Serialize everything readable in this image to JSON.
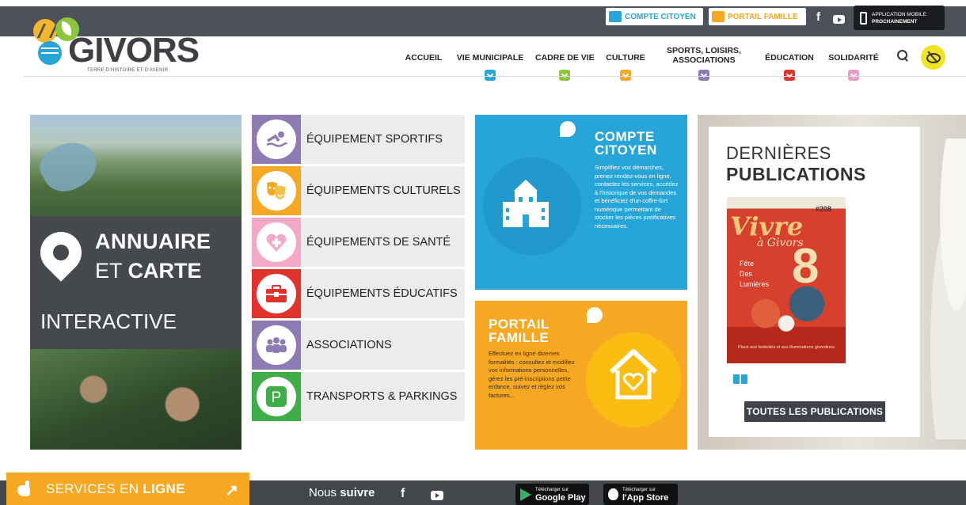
{
  "topbar": {
    "compte_citoyen": "COMPTE CITOYEN",
    "portail_famille": "PORTAIL FAMILLE",
    "facebook": "f",
    "app_line1": "APPLICATION MOBILE",
    "app_line2": "PROCHAINEMENT"
  },
  "logo": {
    "name": "GIVORS",
    "tagline": "TERRE D'HISTOIRE ET D'AVENIR"
  },
  "nav": {
    "items": [
      {
        "label": "ACCUEIL",
        "color": ""
      },
      {
        "label": "VIE MUNICIPALE",
        "color": "#27a4d8"
      },
      {
        "label": "CADRE DE VIE",
        "color": "#8cc63f"
      },
      {
        "label": "CULTURE",
        "color": "#f7a823"
      },
      {
        "label": "SPORTS, LOISIRS,",
        "label2": "ASSOCIATIONS",
        "color": "#8e7bb3"
      },
      {
        "label": "ÉDUCATION",
        "color": "#e0332b"
      },
      {
        "label": "SOLIDARITÉ",
        "color": "#e89cc8"
      }
    ]
  },
  "annuaire": {
    "line1": "ANNUAIRE",
    "line2a": "ET ",
    "line2b": "CARTE",
    "line3": "INTERACTIVE"
  },
  "equipements": [
    {
      "label": "ÉQUIPEMENT SPORTIFS",
      "icon": "swimmer-icon",
      "color": "#8e7bb3"
    },
    {
      "label": "ÉQUIPEMENTS CULTURELS",
      "icon": "theater-masks-icon",
      "color": "#f7a823"
    },
    {
      "label": "ÉQUIPEMENTS DE SANTÉ",
      "icon": "heart-cross-icon",
      "color": "#f4a8c8"
    },
    {
      "label": "ÉQUIPEMENTS ÉDUCATIFS",
      "icon": "briefcase-icon",
      "color": "#e0332b"
    },
    {
      "label": "ASSOCIATIONS",
      "icon": "group-icon",
      "color": "#8e7bb3"
    },
    {
      "label": "TRANSPORTS & PARKINGS",
      "icon": "parking-icon",
      "color": "#3fae49"
    }
  ],
  "citoyen": {
    "title1": "COMPTE",
    "title2": "CITOYEN",
    "desc": "Simplifiez vos démarches, prenez rendez-vous en ligne, contactez les services, accédez à l'historique de vos demandes et bénéficiez d'un coffre-fort numérique permettant de stocker les pièces justificatives nécessaires."
  },
  "famille": {
    "title1": "PORTAIL",
    "title2": "FAMILLE",
    "desc": "Effectuez en ligne diverses formalités : consultez et modifiez vos informations personnelles, gérez les pré-inscriptions petite enfance, suivez et réglez vos factures..."
  },
  "publications": {
    "line1": "DERNIÈRES",
    "line2": "PUBLICATIONS",
    "mag_title": "Vivre",
    "mag_sub": "à Givors",
    "mag_num": "#208",
    "mag_big": "8",
    "mag_fete": "Fête\nDes\nLumières",
    "mag_foot": "Place aux festivités et aux illuminations givordines",
    "button": "TOUTES LES PUBLICATIONS"
  },
  "footer": {
    "services1": "SERVICES EN ",
    "services2": "LIGNE",
    "arrow": "↗",
    "suivre1": "Nous ",
    "suivre2": "suivre",
    "facebook": "f",
    "gp_small": "Télécharger sur",
    "gp_big": "Google Play",
    "as_small": "Télécharger sur",
    "as_big": "l'App Store"
  }
}
